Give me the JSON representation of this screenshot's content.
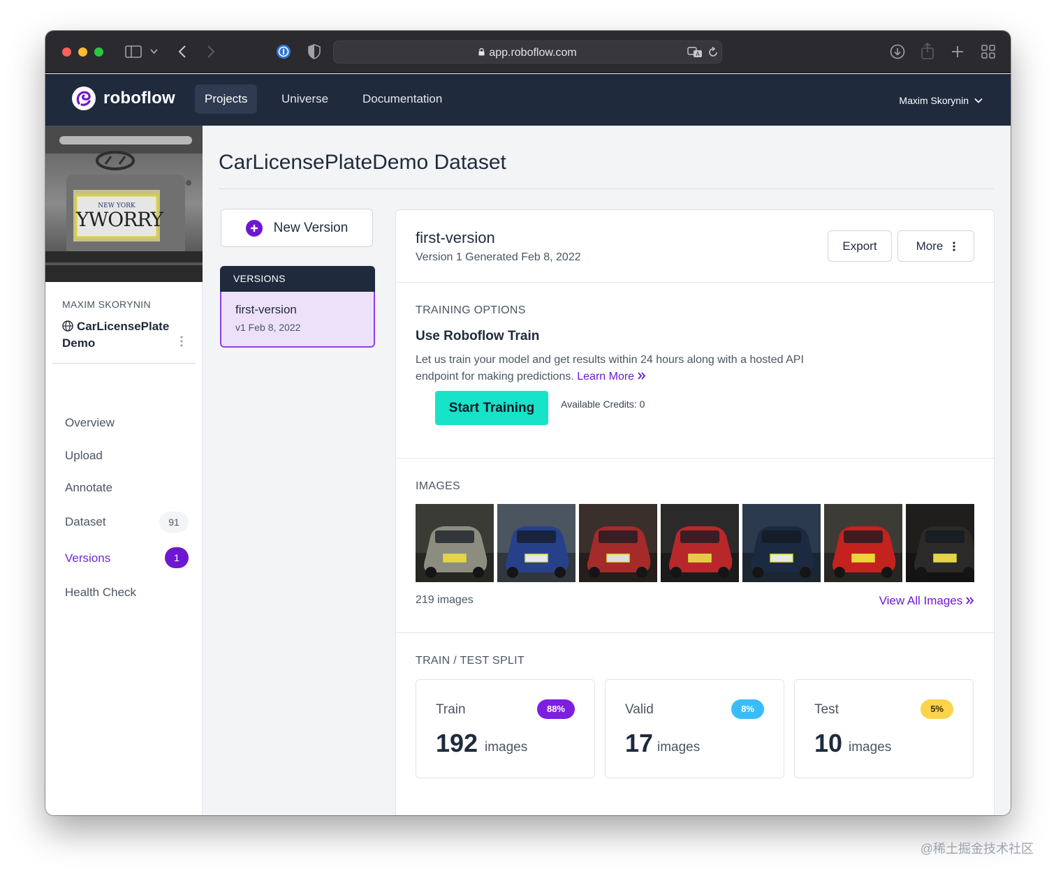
{
  "browser": {
    "url": "app.roboflow.com"
  },
  "nav": {
    "brand": "roboflow",
    "links": [
      "Projects",
      "Universe",
      "Documentation"
    ],
    "active": "Projects",
    "user": "Maxim Skorynin"
  },
  "sidebar": {
    "owner": "MAXIM SKORYNIN",
    "project_line1": "CarLicensePlate",
    "project_line2": "Demo",
    "thumb_plate_text": "YWORRY",
    "thumb_plate_state": "NEW YORK",
    "items": [
      {
        "label": "Overview"
      },
      {
        "label": "Upload"
      },
      {
        "label": "Annotate"
      },
      {
        "label": "Dataset",
        "count": "91"
      },
      {
        "label": "Versions",
        "count": "1"
      },
      {
        "label": "Health Check"
      }
    ]
  },
  "main": {
    "title": "CarLicensePlateDemo Dataset",
    "new_version_label": "New Version",
    "versions_header": "VERSIONS",
    "version_item": {
      "name": "first-version",
      "date": "v1 Feb 8, 2022"
    }
  },
  "card": {
    "title": "first-version",
    "subtitle": "Version 1 Generated Feb 8, 2022",
    "export_label": "Export",
    "more_label": "More",
    "training": {
      "section": "TRAINING OPTIONS",
      "heading": "Use Roboflow Train",
      "desc": "Let us train your model and get results within 24 hours along with a hosted API endpoint for making predictions.",
      "learn_more": "Learn More",
      "button": "Start Training",
      "credits": "Available Credits: 0"
    },
    "images": {
      "section": "IMAGES",
      "count": "219 images",
      "view_all": "View All Images",
      "thumbs": [
        {
          "bg": "#3b3b36",
          "car": "#8c8c80",
          "plate": "#e8d24a"
        },
        {
          "bg": "#4a5560",
          "car": "#27408a",
          "plate": "#e8e8e8"
        },
        {
          "bg": "#3a2f2a",
          "car": "#a52a2a",
          "plate": "#ddd"
        },
        {
          "bg": "#2a2a2a",
          "car": "#b8282a",
          "plate": "#e8c84a"
        },
        {
          "bg": "#2b3a4d",
          "car": "#1b2a40",
          "plate": "#e8e8e8"
        },
        {
          "bg": "#3c3b36",
          "car": "#c4221e",
          "plate": "#f0d23a"
        },
        {
          "bg": "#1f1e1c",
          "car": "#2b2a28",
          "plate": "#e8d24a"
        }
      ]
    },
    "split": {
      "section": "TRAIN / TEST SPLIT",
      "boxes": [
        {
          "name": "Train",
          "pct": "88%",
          "num": "192",
          "unit": "images",
          "bg": "#7c1fe0",
          "fg": "#ffffff"
        },
        {
          "name": "Valid",
          "pct": "8%",
          "num": "17",
          "unit": "images",
          "bg": "#38bdf8",
          "fg": "#ffffff"
        },
        {
          "name": "Test",
          "pct": "5%",
          "num": "10",
          "unit": "images",
          "bg": "#fcd34d",
          "fg": "#3b2f00"
        }
      ]
    }
  },
  "watermark": "@稀土掘金技术社区",
  "colors": {
    "nav_bg": "#1f2a3d",
    "accent_purple": "#6d18d0",
    "train_button": "#16e3c8"
  }
}
